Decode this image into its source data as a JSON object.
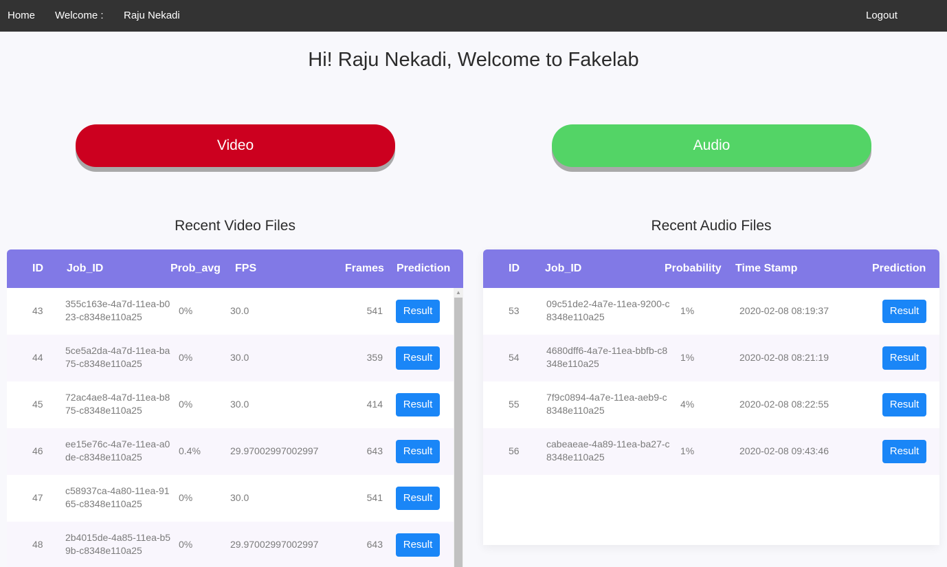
{
  "nav": {
    "home": "Home",
    "welcome": "Welcome :",
    "user": "Raju Nekadi",
    "logout": "Logout"
  },
  "page": {
    "title": "Hi! Raju Nekadi, Welcome to Fakelab",
    "video_button": "Video",
    "audio_button": "Audio"
  },
  "colors": {
    "nav_bg": "#333333",
    "video_button": "#cc001f",
    "audio_button": "#53d466",
    "table_header": "#8179e6",
    "result_button": "#1a86f7"
  },
  "video": {
    "title": "Recent Video Files",
    "headers": [
      "ID",
      "Job_ID",
      "Prob_avg",
      "FPS",
      "Frames",
      "Prediction"
    ],
    "rows": [
      {
        "id": "43",
        "job_id": "355c163e-4a7d-11ea-b023-c8348e110a25",
        "prob_avg": "0%",
        "fps": "30.0",
        "frames": "541",
        "prediction": "Result"
      },
      {
        "id": "44",
        "job_id": "5ce5a2da-4a7d-11ea-ba75-c8348e110a25",
        "prob_avg": "0%",
        "fps": "30.0",
        "frames": "359",
        "prediction": "Result"
      },
      {
        "id": "45",
        "job_id": "72ac4ae8-4a7d-11ea-b875-c8348e110a25",
        "prob_avg": "0%",
        "fps": "30.0",
        "frames": "414",
        "prediction": "Result"
      },
      {
        "id": "46",
        "job_id": "ee15e76c-4a7e-11ea-a0de-c8348e110a25",
        "prob_avg": "0.4%",
        "fps": "29.97002997002997",
        "frames": "643",
        "prediction": "Result"
      },
      {
        "id": "47",
        "job_id": "c58937ca-4a80-11ea-9165-c8348e110a25",
        "prob_avg": "0%",
        "fps": "30.0",
        "frames": "541",
        "prediction": "Result"
      },
      {
        "id": "48",
        "job_id": "2b4015de-4a85-11ea-b59b-c8348e110a25",
        "prob_avg": "0%",
        "fps": "29.97002997002997",
        "frames": "643",
        "prediction": "Result"
      }
    ]
  },
  "audio": {
    "title": "Recent Audio Files",
    "headers": [
      "ID",
      "Job_ID",
      "Probability",
      "Time Stamp",
      "Prediction"
    ],
    "rows": [
      {
        "id": "53",
        "job_id": "09c51de2-4a7e-11ea-9200-c8348e110a25",
        "probability": "1%",
        "timestamp": "2020-02-08 08:19:37",
        "prediction": "Result"
      },
      {
        "id": "54",
        "job_id": "4680dff6-4a7e-11ea-bbfb-c8348e110a25",
        "probability": "1%",
        "timestamp": "2020-02-08 08:21:19",
        "prediction": "Result"
      },
      {
        "id": "55",
        "job_id": "7f9c0894-4a7e-11ea-aeb9-c8348e110a25",
        "probability": "4%",
        "timestamp": "2020-02-08 08:22:55",
        "prediction": "Result"
      },
      {
        "id": "56",
        "job_id": "cabeaeae-4a89-11ea-ba27-c8348e110a25",
        "probability": "1%",
        "timestamp": "2020-02-08 09:43:46",
        "prediction": "Result"
      }
    ]
  }
}
